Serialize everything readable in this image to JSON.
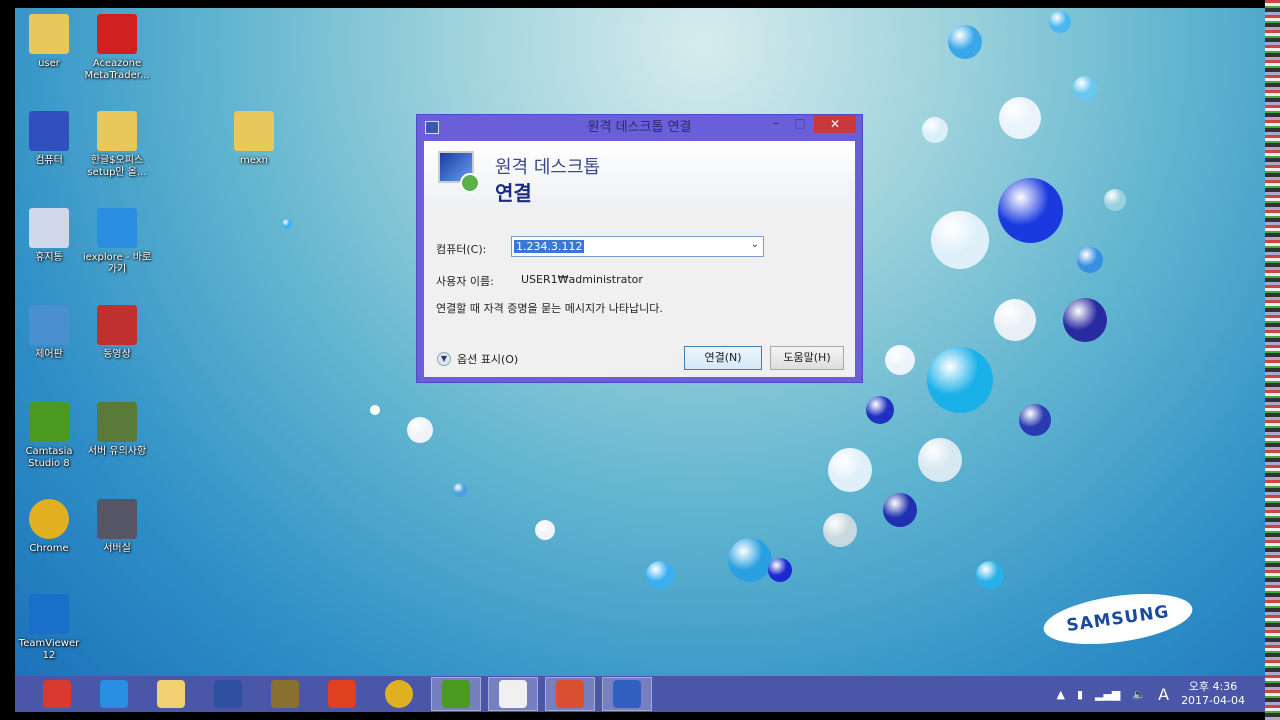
{
  "desktop": {
    "icons": [
      {
        "label": "user",
        "icon": "user-folder-icon"
      },
      {
        "label": "Aceazone MetaTrader...",
        "icon": "aceazone-icon"
      },
      {
        "label": "컴퓨터",
        "icon": "computer-icon"
      },
      {
        "label": "한글$오피스 setup만 올...",
        "icon": "folder-icon"
      },
      {
        "label": "mexn",
        "icon": "folder-icon"
      },
      {
        "label": "휴지통",
        "icon": "recycle-bin-icon"
      },
      {
        "label": "iexplore - 바로 가기",
        "icon": "internet-explorer-icon"
      },
      {
        "label": "제어판",
        "icon": "control-panel-icon"
      },
      {
        "label": "동영상",
        "icon": "videos-folder-icon"
      },
      {
        "label": "Camtasia Studio 8",
        "icon": "camtasia-icon"
      },
      {
        "label": "서버 유의사항",
        "icon": "document-icon"
      },
      {
        "label": "Chrome",
        "icon": "chrome-icon"
      },
      {
        "label": "서버실",
        "icon": "image-icon"
      },
      {
        "label": "TeamViewer 12",
        "icon": "teamviewer-icon"
      }
    ],
    "brand": "SAMSUNG"
  },
  "dialog": {
    "title": "원격 데스크톱 연결",
    "header_line1": "원격 데스크톱",
    "header_line2": "연결",
    "computer_label": "컴퓨터(C):",
    "computer_value": "1.234.3.112",
    "user_label": "사용자 이름:",
    "user_value": "USER1₩administrator",
    "info": "연결할 때 자격 증명을 묻는 메시지가 나타납니다.",
    "options_label": "옵션 표시(O)",
    "connect_button": "연결(N)",
    "help_button": "도움말(H)",
    "close": "✕",
    "minimize": "–",
    "maximize": "□"
  },
  "taskbar": {
    "items": [
      {
        "name": "shutdown",
        "color": "#d83a30",
        "active": false
      },
      {
        "name": "internet-explorer",
        "color": "#2a8ee0",
        "active": false
      },
      {
        "name": "file-explorer",
        "color": "#f0d070",
        "active": false
      },
      {
        "name": "help",
        "color": "#3050a0",
        "active": false
      },
      {
        "name": "archive",
        "color": "#8a7030",
        "active": false
      },
      {
        "name": "office",
        "color": "#e04020",
        "active": false
      },
      {
        "name": "chrome",
        "color": "#e0b020",
        "active": false
      },
      {
        "name": "camtasia-studio",
        "color": "#4a9a20",
        "active": true
      },
      {
        "name": "camtasia-recorder",
        "color": "#f0f0f0",
        "active": true
      },
      {
        "name": "powerpoint",
        "color": "#d85030",
        "active": true
      },
      {
        "name": "remote-desktop",
        "color": "#3060c0",
        "active": true
      }
    ],
    "tray": {
      "ime": "A",
      "time": "오후 4:36",
      "date": "2017-04-04"
    }
  }
}
